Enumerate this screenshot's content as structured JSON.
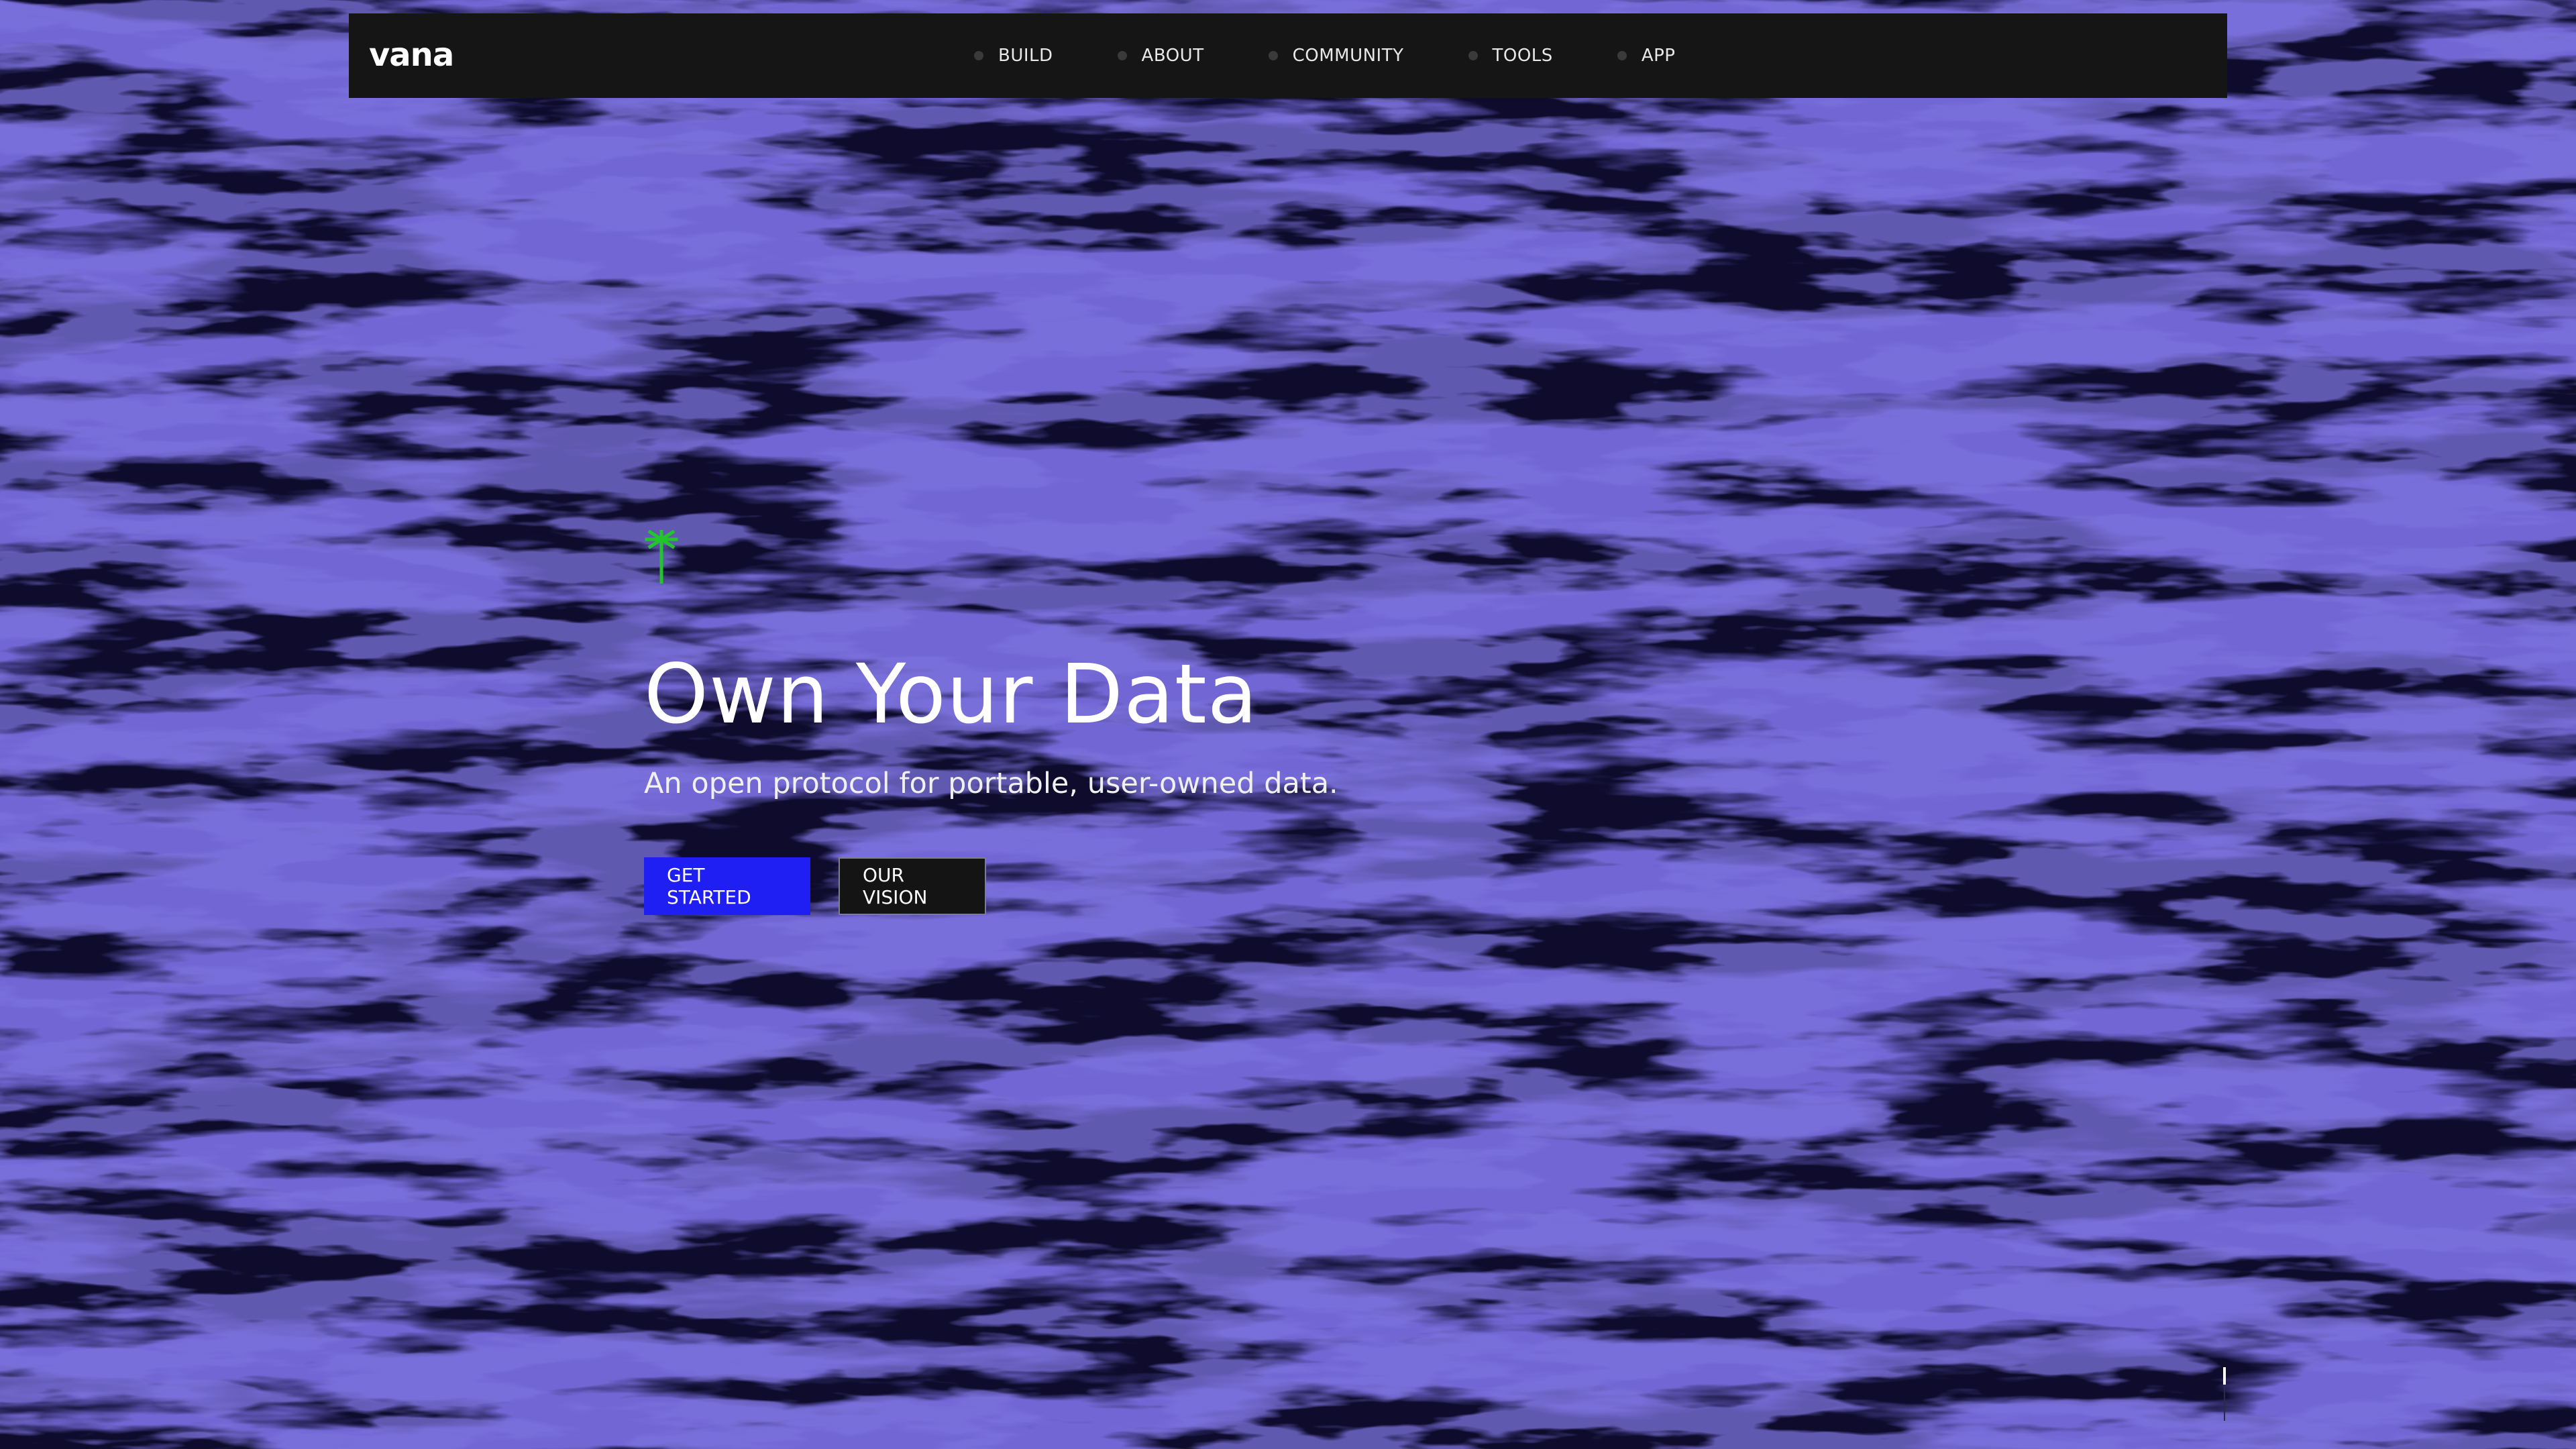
{
  "header": {
    "logo_text": "vana",
    "nav": [
      {
        "label": "BUILD"
      },
      {
        "label": "ABOUT"
      },
      {
        "label": "COMMUNITY"
      },
      {
        "label": "TOOLS"
      },
      {
        "label": "APP"
      }
    ]
  },
  "hero": {
    "icon": "palm-tree-icon",
    "title": "Own Your Data",
    "subtitle": "An open protocol for portable, user-owned data.",
    "primary_button": "GET STARTED",
    "secondary_button": "OUR VISION"
  },
  "colors": {
    "background": "#0e0b2c",
    "texture_blue": "#2a22a6",
    "header_bg": "#151515",
    "accent_blue": "#1f1ff4",
    "icon_green": "#22c62a"
  }
}
